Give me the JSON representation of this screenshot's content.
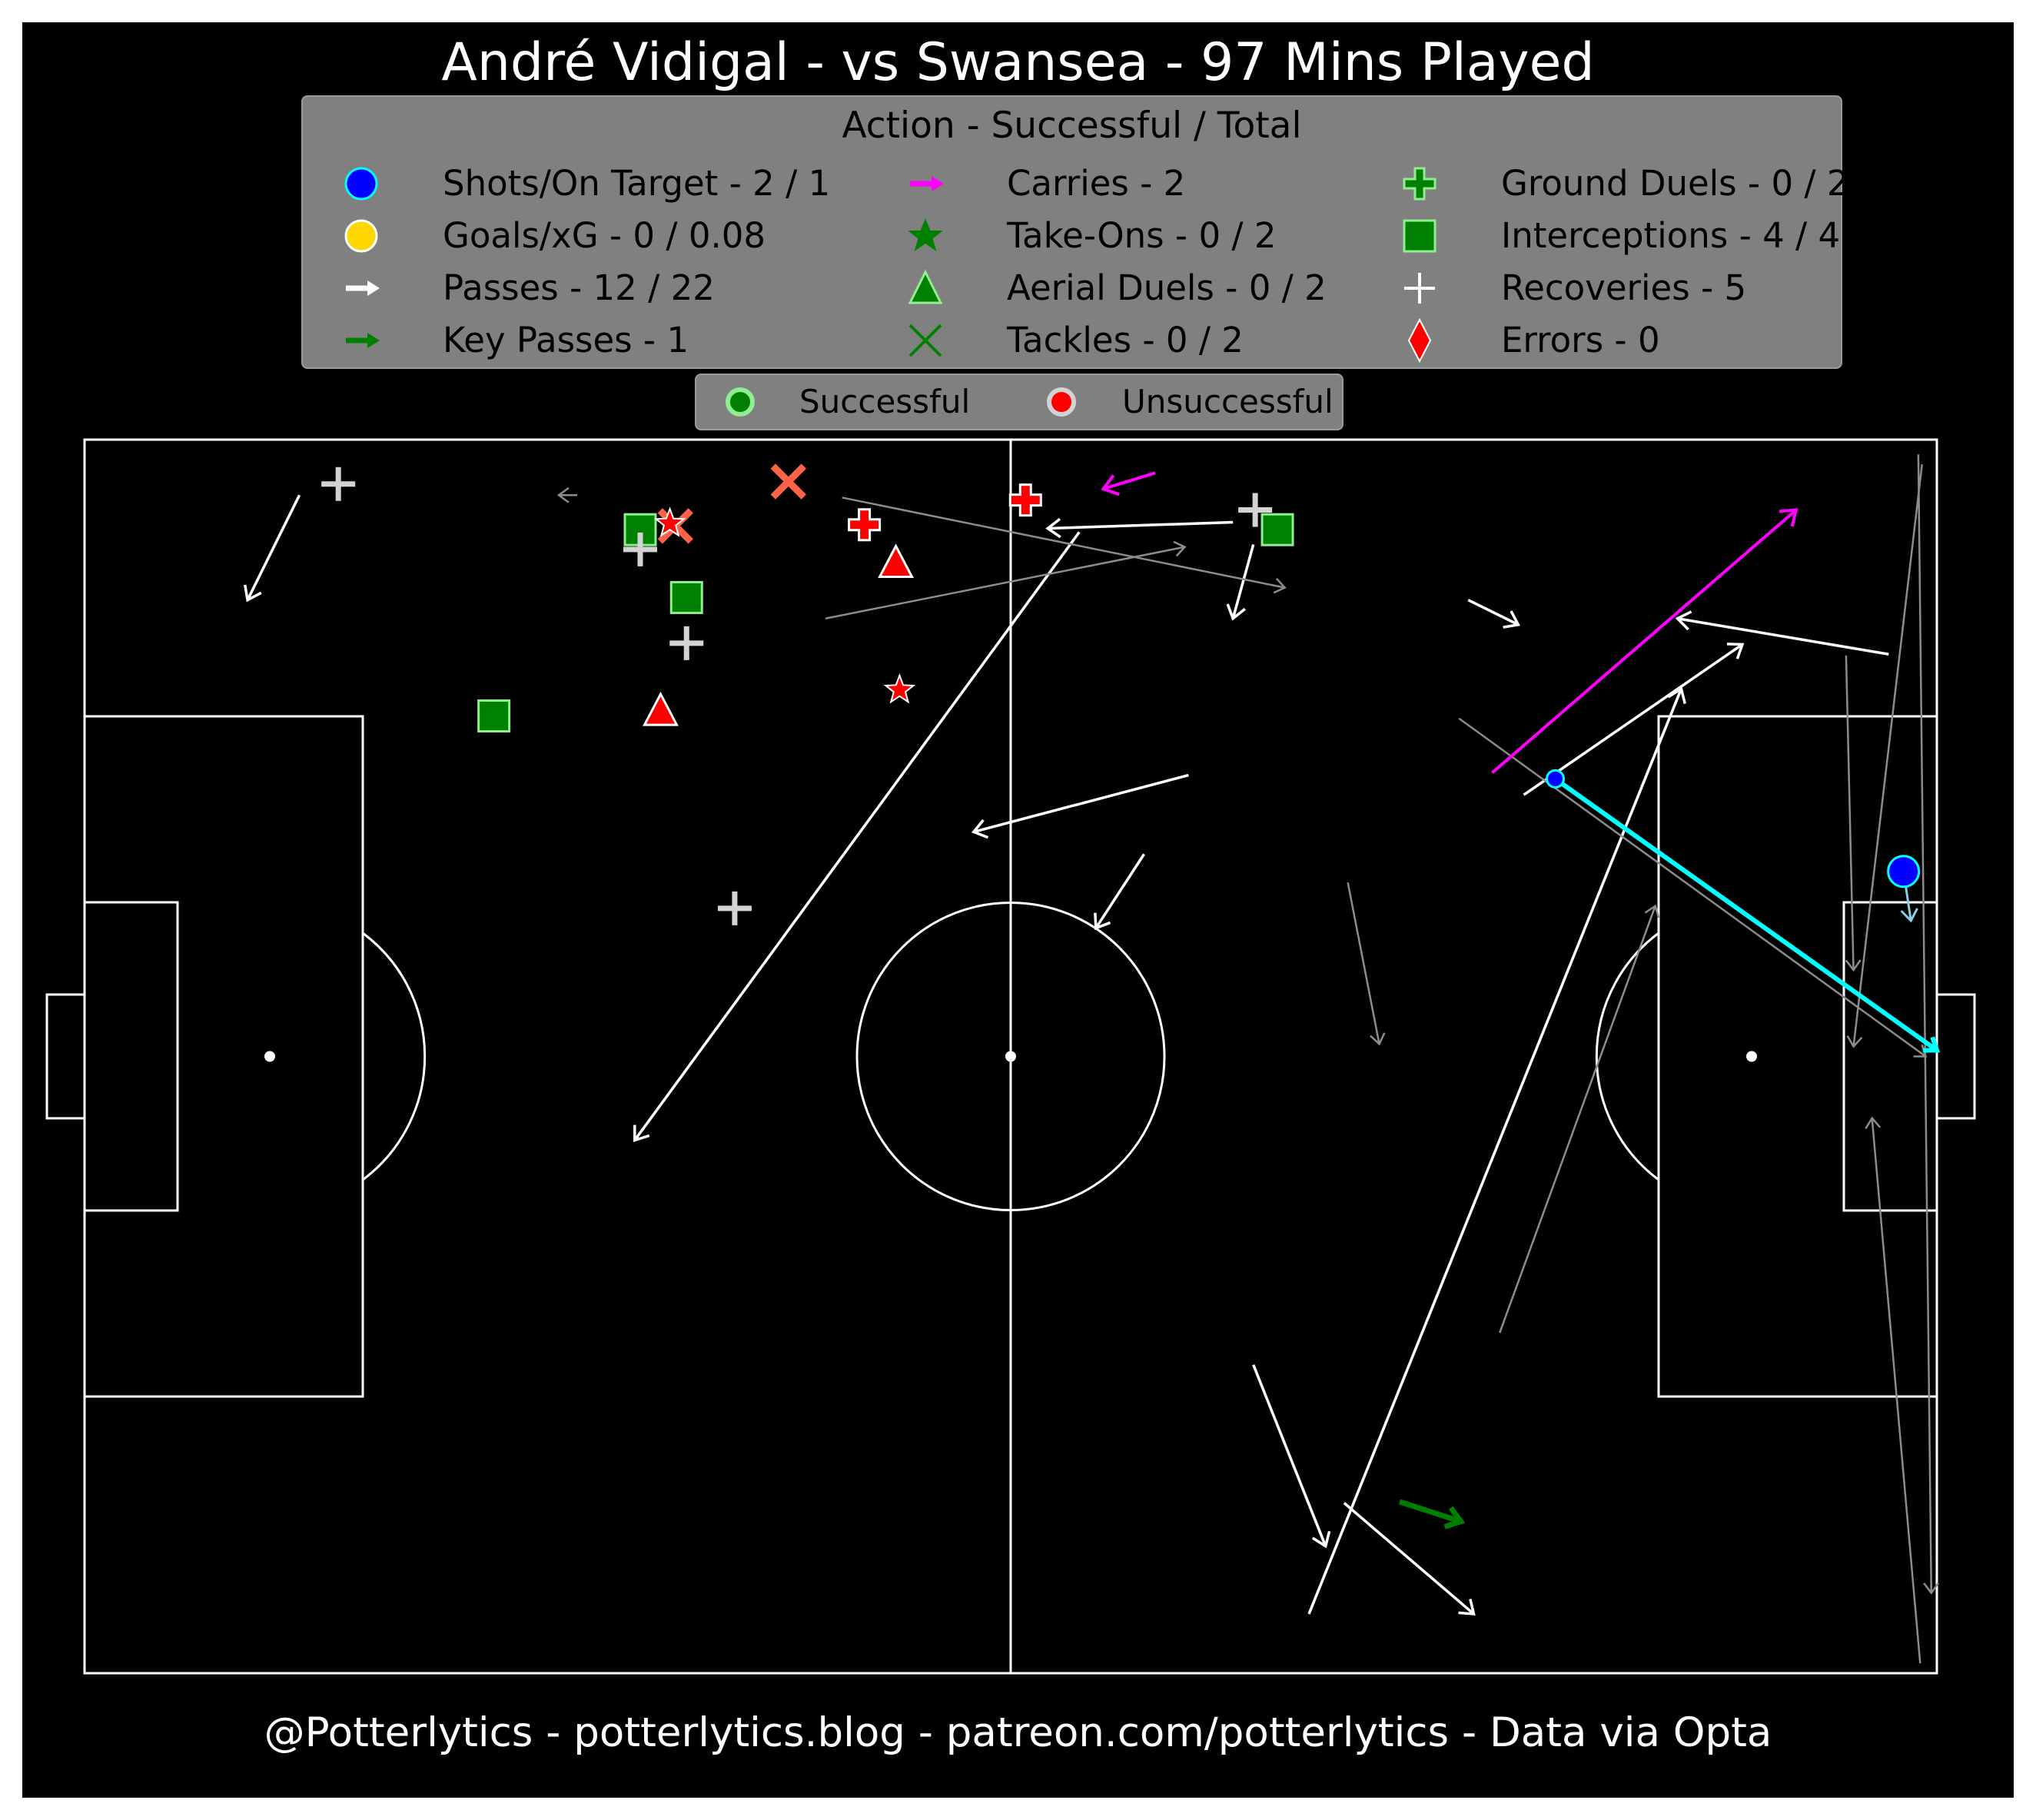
{
  "title": "André Vidigal - vs Swansea - 97 Mins Played",
  "footer": "@Potterlytics - potterlytics.blog - patreon.com/potterlytics - Data via Opta",
  "legend": {
    "title": "Action - Successful / Total",
    "items": [
      {
        "label": "Shots/On Target - 2 / 1",
        "icon": "blue-circle-icon"
      },
      {
        "label": "Goals/xG - 0 / 0.08",
        "icon": "gold-circle-icon"
      },
      {
        "label": "Passes - 12 / 22",
        "icon": "white-arrow-icon"
      },
      {
        "label": "Key Passes - 1",
        "icon": "green-arrow-icon"
      },
      {
        "label": "Carries - 2",
        "icon": "magenta-arrow-icon"
      },
      {
        "label": "Take-Ons - 0 / 2",
        "icon": "green-star-icon"
      },
      {
        "label": "Aerial Duels - 0 / 2",
        "icon": "green-triangle-icon"
      },
      {
        "label": "Tackles - 0 / 2",
        "icon": "green-x-icon"
      },
      {
        "label": "Ground Duels - 0 / 2",
        "icon": "green-plus-icon"
      },
      {
        "label": "Interceptions - 4 / 4",
        "icon": "green-square-icon"
      },
      {
        "label": "Recoveries - 5",
        "icon": "white-plus-icon"
      },
      {
        "label": "Errors - 0",
        "icon": "red-diamond-icon"
      }
    ],
    "outcome": {
      "success": "Successful",
      "fail": "Unsuccessful"
    }
  },
  "colors": {
    "background": "#000000",
    "pitch_lines": "#ffffff",
    "shot": "#0000ff",
    "shot_edge": "#00ffff",
    "goal": "#ffd700",
    "pass_success": "#ffffff",
    "pass_fail": "#8c8c8c",
    "key_pass": "#007f00",
    "carry": "#ff00ff",
    "success": "#008000",
    "success_edge": "#90ee90",
    "fail": "#ff0000",
    "tackle_fail": "#ff6347",
    "recovery": "#d3d3d3",
    "shot_line": "#00ffff"
  },
  "chart_data": {
    "type": "scatter",
    "title": "André Vidigal - vs Swansea - 97 Mins Played",
    "xlim": [
      0,
      100
    ],
    "ylim": [
      0,
      100
    ],
    "shots": [
      {
        "x": 79.4,
        "y": 72.5,
        "end_x": 100.0,
        "end_y": 50.5,
        "on_target": false
      },
      {
        "x": 98.2,
        "y": 65.0,
        "end_x": 98.6,
        "end_y": 61.0,
        "on_target": true
      }
    ],
    "passes": [
      {
        "x": 11.6,
        "y": 95.5,
        "end_x": 8.8,
        "end_y": 87.0,
        "success": true
      },
      {
        "x": 62.0,
        "y": 93.3,
        "end_x": 52.0,
        "end_y": 92.8,
        "success": true
      },
      {
        "x": 53.7,
        "y": 92.5,
        "end_x": 29.7,
        "end_y": 43.2,
        "success": true
      },
      {
        "x": 63.1,
        "y": 91.5,
        "end_x": 62.0,
        "end_y": 85.5,
        "success": true
      },
      {
        "x": 74.7,
        "y": 87.0,
        "end_x": 77.4,
        "end_y": 85.0,
        "success": true
      },
      {
        "x": 97.4,
        "y": 82.6,
        "end_x": 86.0,
        "end_y": 85.5,
        "success": true
      },
      {
        "x": 59.6,
        "y": 72.8,
        "end_x": 48.0,
        "end_y": 68.2,
        "success": true
      },
      {
        "x": 57.2,
        "y": 66.4,
        "end_x": 54.6,
        "end_y": 60.4,
        "success": true
      },
      {
        "x": 63.1,
        "y": 25.0,
        "end_x": 67.0,
        "end_y": 10.3,
        "success": true
      },
      {
        "x": 68.0,
        "y": 13.8,
        "end_x": 75.0,
        "end_y": 4.8,
        "success": true
      },
      {
        "x": 66.1,
        "y": 4.8,
        "end_x": 86.2,
        "end_y": 79.8,
        "success": true
      },
      {
        "x": 77.7,
        "y": 71.2,
        "end_x": 89.5,
        "end_y": 83.4,
        "success": true
      },
      {
        "x": 26.6,
        "y": 95.5,
        "end_x": 25.6,
        "end_y": 95.5,
        "success": false
      },
      {
        "x": 40.9,
        "y": 95.3,
        "end_x": 64.8,
        "end_y": 88.0,
        "success": false
      },
      {
        "x": 40.0,
        "y": 85.5,
        "end_x": 59.4,
        "end_y": 91.3,
        "success": false
      },
      {
        "x": 74.2,
        "y": 77.4,
        "end_x": 99.4,
        "end_y": 50.0,
        "success": false
      },
      {
        "x": 68.2,
        "y": 64.1,
        "end_x": 69.9,
        "end_y": 51.0,
        "success": false
      },
      {
        "x": 76.4,
        "y": 27.6,
        "end_x": 84.8,
        "end_y": 62.2,
        "success": false
      },
      {
        "x": 99.1,
        "y": 0.8,
        "end_x": 96.5,
        "end_y": 45.0,
        "success": false
      },
      {
        "x": 99.0,
        "y": 98.8,
        "end_x": 99.7,
        "end_y": 6.5,
        "success": false
      },
      {
        "x": 95.1,
        "y": 82.5,
        "end_x": 95.5,
        "end_y": 57.0,
        "success": false
      },
      {
        "x": 99.2,
        "y": 98.0,
        "end_x": 95.5,
        "end_y": 50.8,
        "success": false
      }
    ],
    "key_passes": [
      {
        "x": 71.0,
        "y": 13.9,
        "end_x": 74.3,
        "end_y": 12.3
      }
    ],
    "carries": [
      {
        "x": 57.8,
        "y": 97.3,
        "end_x": 55.0,
        "end_y": 96.0
      },
      {
        "x": 76.0,
        "y": 73.0,
        "end_x": 92.4,
        "end_y": 94.3
      }
    ],
    "take_ons": [
      {
        "x": 31.6,
        "y": 93.2,
        "success": false
      },
      {
        "x": 44.0,
        "y": 79.7,
        "success": false
      }
    ],
    "aerial_duels": [
      {
        "x": 43.8,
        "y": 90.0,
        "success": false
      },
      {
        "x": 31.1,
        "y": 78.0,
        "success": false
      }
    ],
    "tackles": [
      {
        "x": 31.9,
        "y": 93.0,
        "success": false
      },
      {
        "x": 38.0,
        "y": 96.6,
        "success": false
      }
    ],
    "ground_duels": [
      {
        "x": 42.1,
        "y": 93.1,
        "success": false
      },
      {
        "x": 50.8,
        "y": 95.1,
        "success": false
      }
    ],
    "interceptions": [
      {
        "x": 30.0,
        "y": 92.7,
        "success": true
      },
      {
        "x": 32.5,
        "y": 87.2,
        "success": true
      },
      {
        "x": 22.1,
        "y": 77.6,
        "success": true
      },
      {
        "x": 64.4,
        "y": 92.7,
        "success": true
      }
    ],
    "recoveries": [
      {
        "x": 13.7,
        "y": 96.4
      },
      {
        "x": 30.0,
        "y": 91.1
      },
      {
        "x": 32.5,
        "y": 83.5
      },
      {
        "x": 35.1,
        "y": 62.0
      },
      {
        "x": 63.2,
        "y": 94.3
      }
    ],
    "errors": []
  }
}
